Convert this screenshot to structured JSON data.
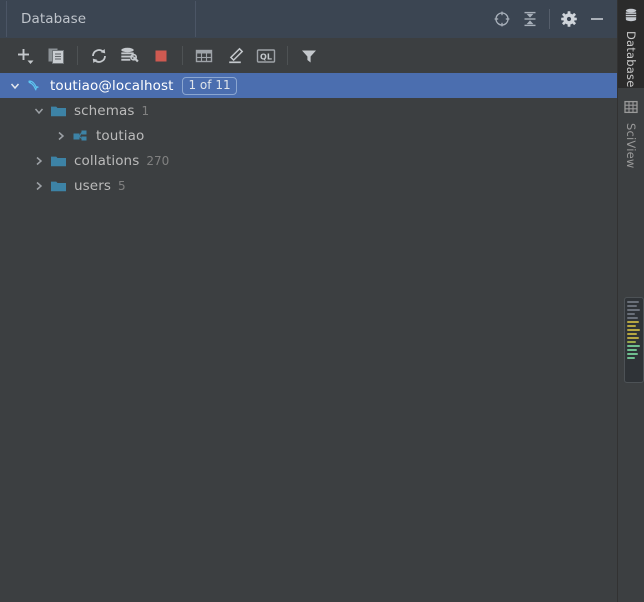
{
  "window": {
    "title": "Database"
  },
  "header": {
    "tab_label": "Database",
    "actions": [
      {
        "name": "scroll-from-source-icon",
        "label": "Scroll from Source"
      },
      {
        "name": "collapse-all-icon",
        "label": "Collapse All"
      },
      {
        "name": "gear-icon",
        "label": "Settings"
      },
      {
        "name": "minimize-icon",
        "label": "Hide"
      }
    ]
  },
  "toolbar": {
    "buttons": [
      {
        "name": "add-data-source-button",
        "label": "New"
      },
      {
        "name": "duplicate-button",
        "label": "Duplicate"
      },
      {
        "name": "refresh-button",
        "label": "Refresh"
      },
      {
        "name": "data-source-properties-button",
        "label": "Properties"
      },
      {
        "name": "stop-button",
        "label": "Stop"
      },
      {
        "name": "open-table-editor-button",
        "label": "Open Table Editor"
      },
      {
        "name": "modify-button",
        "label": "Modify"
      },
      {
        "name": "query-console-button",
        "label": "QL Console"
      },
      {
        "name": "filter-button",
        "label": "Filter"
      }
    ],
    "ql_text": "QL"
  },
  "tree": {
    "rows": [
      {
        "name": "tree-row-datasource",
        "label": "toutiao@localhost",
        "icon": "mysql-dolphin-icon",
        "indent": 0,
        "expanded": true,
        "selected": true,
        "badge": "1 of 11",
        "count": ""
      },
      {
        "name": "tree-row-schemas",
        "label": "schemas",
        "icon": "folder-icon",
        "indent": 1,
        "expanded": true,
        "selected": false,
        "badge": "",
        "count": "1"
      },
      {
        "name": "tree-row-toutiao-schema",
        "label": "toutiao",
        "icon": "schema-icon",
        "indent": 2,
        "expanded": false,
        "selected": false,
        "badge": "",
        "count": ""
      },
      {
        "name": "tree-row-collations",
        "label": "collations",
        "icon": "folder-icon",
        "indent": 1,
        "expanded": false,
        "selected": false,
        "badge": "",
        "count": "270"
      },
      {
        "name": "tree-row-users",
        "label": "users",
        "icon": "folder-icon",
        "indent": 1,
        "expanded": false,
        "selected": false,
        "badge": "",
        "count": "5"
      }
    ]
  },
  "right_stripe": {
    "tabs": [
      {
        "name": "stripe-tab-database",
        "label": "Database",
        "icon": "database-icon",
        "active": true
      },
      {
        "name": "stripe-tab-sciview",
        "label": "SciView",
        "icon": "grid-table-icon",
        "active": false
      }
    ]
  },
  "minimap": {
    "name": "code-minimap",
    "lines": [
      {
        "color": "#6a7079",
        "width": "85%"
      },
      {
        "color": "#6a7079",
        "width": "70%"
      },
      {
        "color": "#6a7079",
        "width": "90%"
      },
      {
        "color": "#6a7079",
        "width": "60%"
      },
      {
        "color": "#6a7079",
        "width": "78%"
      },
      {
        "color": "#b5a642",
        "width": "88%"
      },
      {
        "color": "#b5a642",
        "width": "66%"
      },
      {
        "color": "#b5a642",
        "width": "92%"
      },
      {
        "color": "#b5a642",
        "width": "74%"
      },
      {
        "color": "#b5a642",
        "width": "84%"
      },
      {
        "color": "#9aa84a",
        "width": "62%"
      },
      {
        "color": "#6fbf8f",
        "width": "90%"
      },
      {
        "color": "#6fbf8f",
        "width": "70%"
      },
      {
        "color": "#6fbf8f",
        "width": "80%"
      },
      {
        "color": "#6fbf8f",
        "width": "58%"
      }
    ]
  },
  "colors": {
    "panel_bg": "#3c3f41",
    "header_bg": "#3b4552",
    "selection_blue": "#4b6eaf",
    "folder_teal": "#3d83a6",
    "stop_red": "#cf5a51",
    "text": "#bbbbbb",
    "muted_text": "#808080"
  }
}
